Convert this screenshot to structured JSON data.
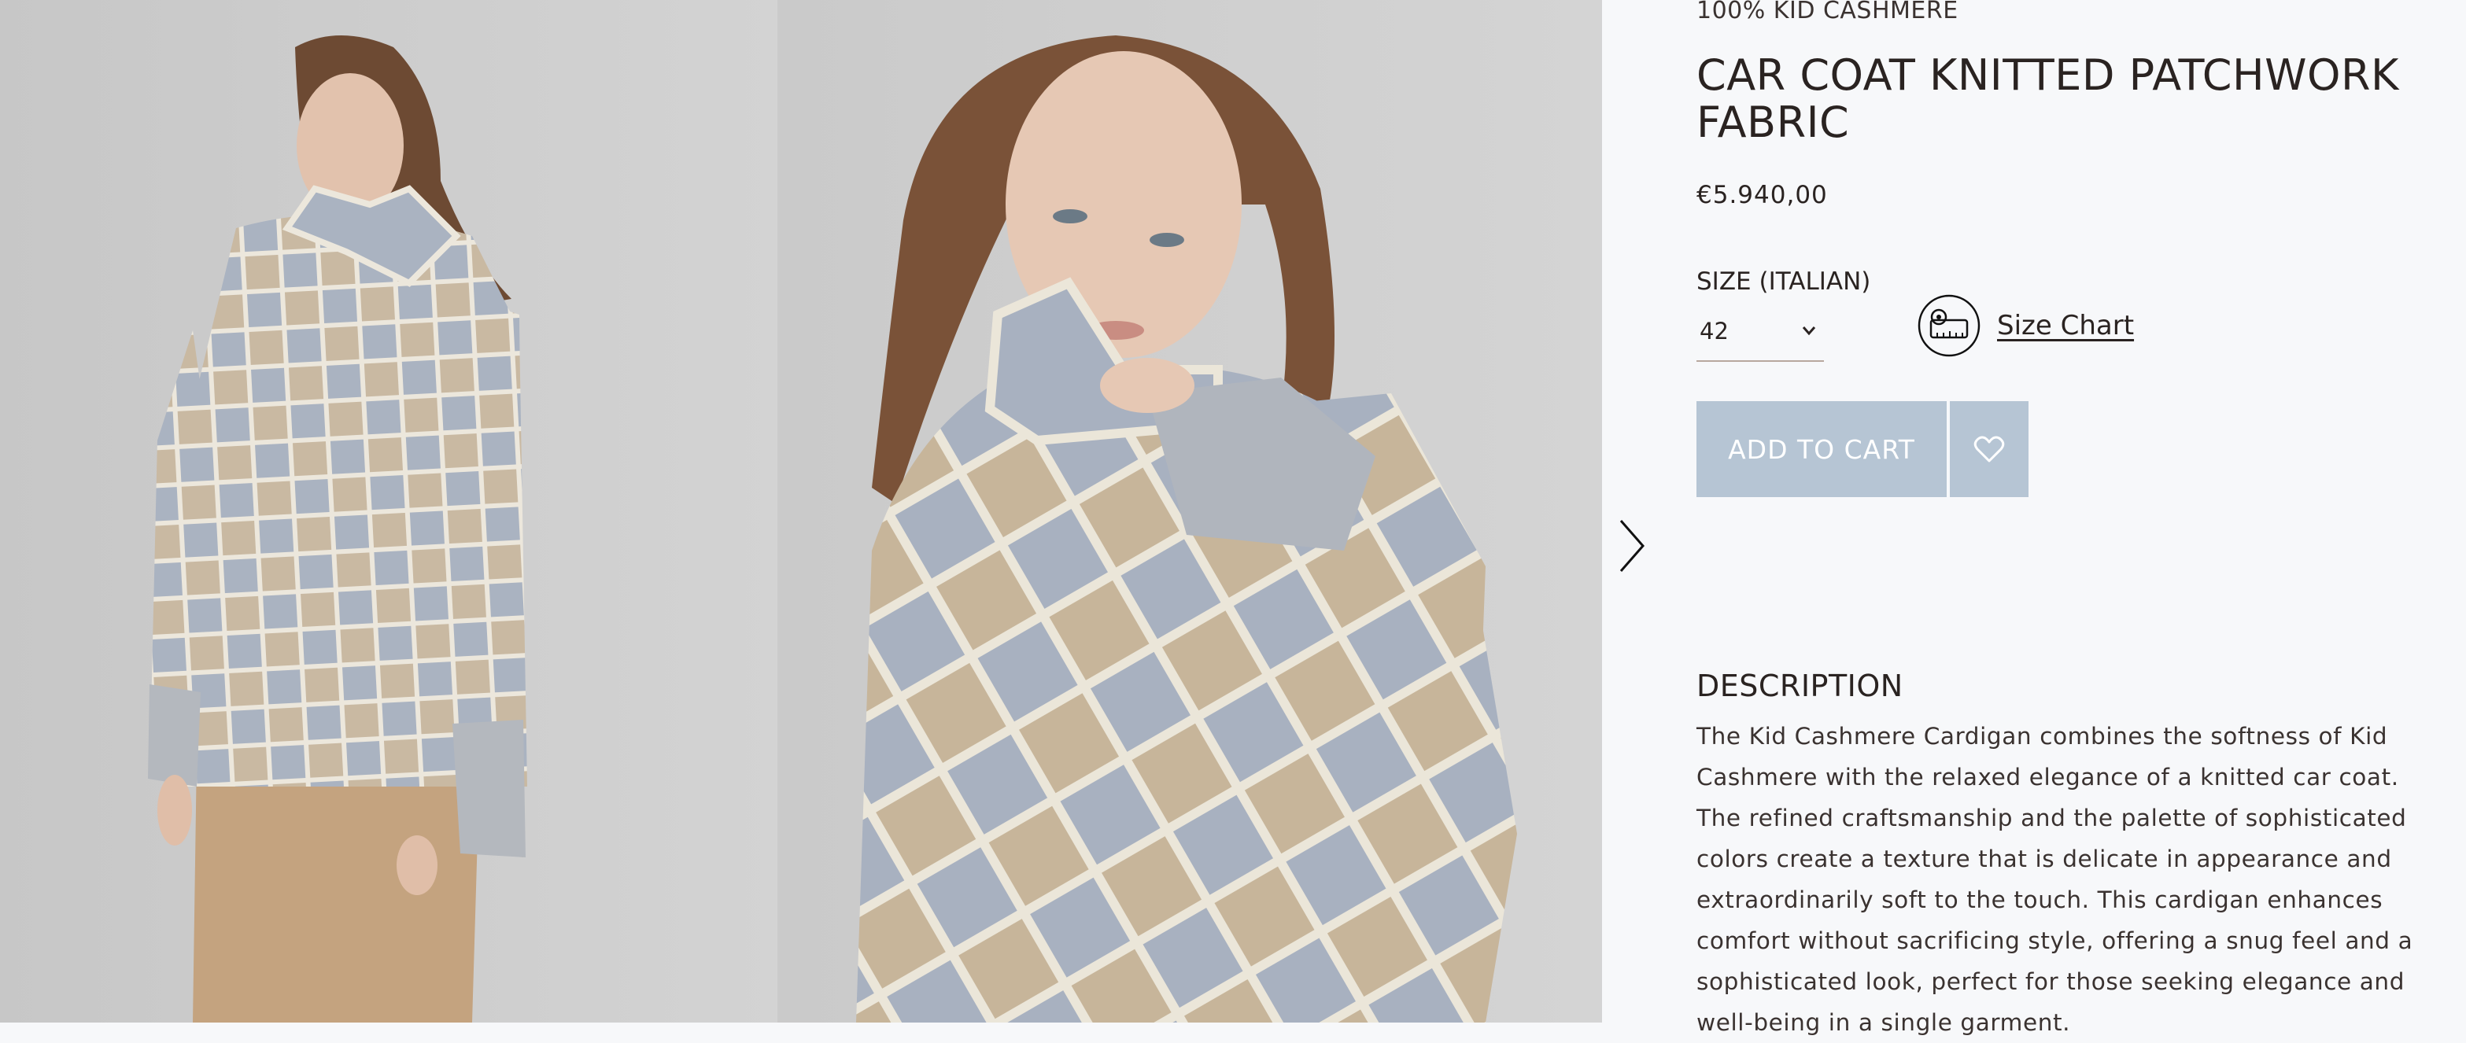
{
  "gallery": {
    "photos": [
      {
        "alt": "Model wearing the patchwork knitted car coat, full view"
      },
      {
        "alt": "Model wearing the patchwork knitted car coat, close-up"
      }
    ],
    "next_icon": "chevron-right-icon"
  },
  "product": {
    "material": "100% KID CASHMERE",
    "title": "CAR COAT KNITTED PATCHWORK FABRIC",
    "price": "€5.940,00",
    "size_label": "SIZE (ITALIAN)",
    "size_value": "42",
    "size_chart_label": "Size Chart",
    "size_chart_icon": "tape-measure-icon",
    "add_to_cart_label": "ADD TO CART",
    "wishlist_icon": "heart-icon",
    "description_title": "DESCRIPTION",
    "description_text": "The Kid Cashmere Cardigan combines the softness of Kid Cashmere with the relaxed elegance of a knitted car coat. The refined craftsmanship and the palette of sophisticated colors create a texture that is delicate in appearance and extraordinarily soft to the touch. This cardigan enhances comfort without sacrificing style, offering a snug feel and a sophisticated look, perfect for those seeking elegance and well-being in a single garment."
  },
  "colors": {
    "button_bg": "#b6c5d4",
    "page_bg": "#f7f8fa",
    "text": "#2a2321"
  }
}
